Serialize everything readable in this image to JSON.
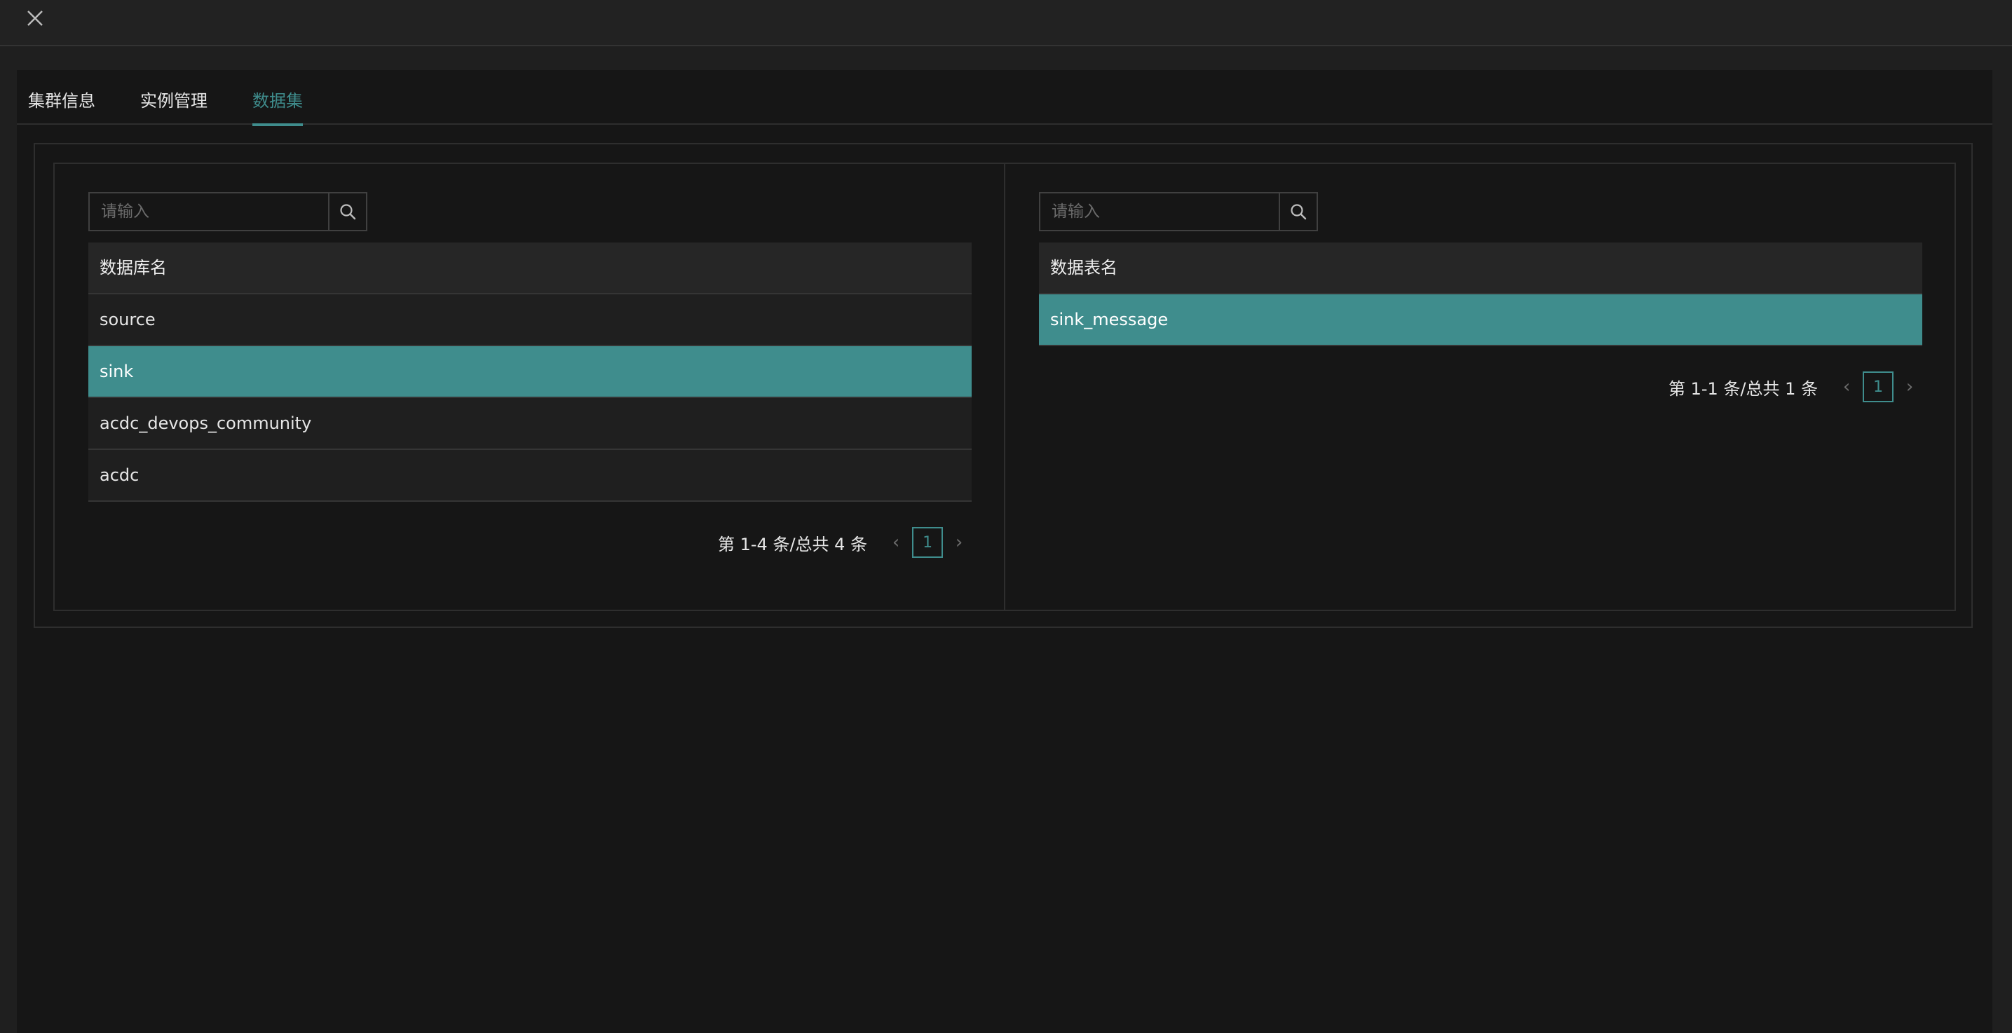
{
  "tabs": [
    {
      "label": "集群信息"
    },
    {
      "label": "实例管理"
    },
    {
      "label": "数据集"
    }
  ],
  "active_tab": "数据集",
  "left_panel": {
    "search_placeholder": "请输入",
    "column_header": "数据库名",
    "rows": [
      "source",
      "sink",
      "acdc_devops_community",
      "acdc"
    ],
    "selected_row": "sink",
    "pagination": {
      "total_text": "第 1-4 条/总共 4 条",
      "current_page": "1"
    }
  },
  "right_panel": {
    "search_placeholder": "请输入",
    "column_header": "数据表名",
    "rows": [
      "sink_message"
    ],
    "selected_row": "sink_message",
    "pagination": {
      "total_text": "第 1-1 条/总共 1 条",
      "current_page": "1"
    }
  },
  "icons": {
    "close": "close-icon",
    "search": "search-icon",
    "prev": "chevron-left-icon",
    "next": "chevron-right-icon"
  },
  "colors": {
    "accent": "#3f8d8d",
    "background": "#161616",
    "header_bg": "#262626",
    "row_bg": "#1f1f1f"
  }
}
